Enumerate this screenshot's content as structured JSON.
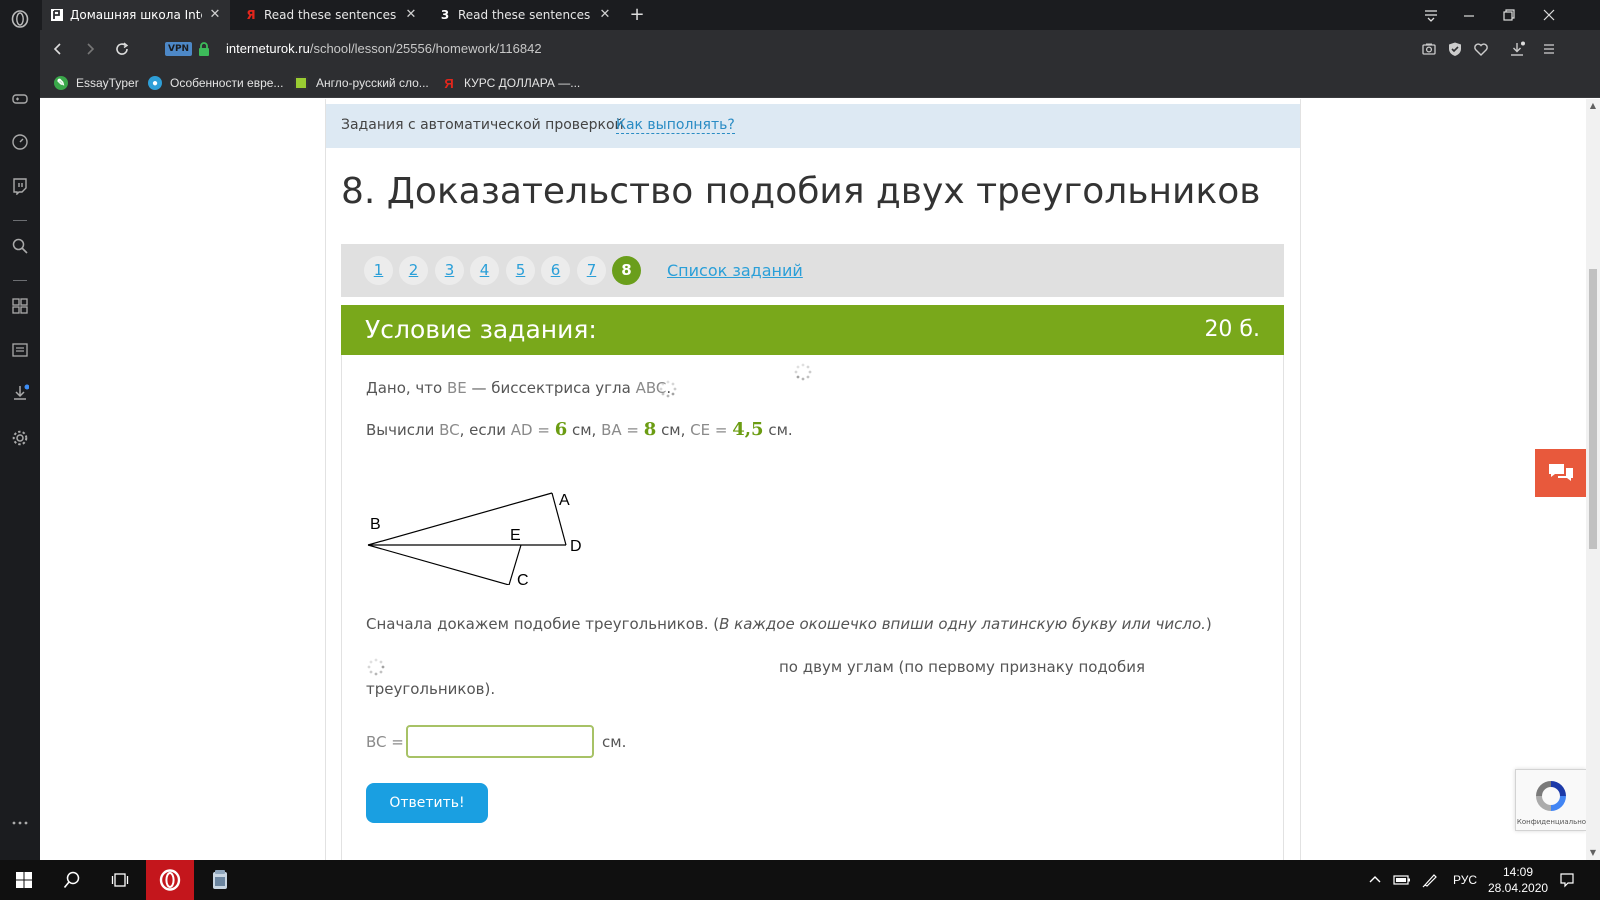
{
  "browser": {
    "tabs": [
      {
        "title": "Домашняя школа Internet",
        "active": true,
        "favicon": "interneturok-icon"
      },
      {
        "title": "Read these sentences and c",
        "active": false,
        "favicon": "yandex-icon"
      },
      {
        "title": "Read these sentences and f",
        "active": false,
        "favicon": "number-3-icon",
        "favicon_text": "3"
      }
    ],
    "new_tab_label": "+",
    "url_host": "interneturok.ru",
    "url_path": "/school/lesson/25556/homework/116842",
    "vpn_label": "VPN",
    "bookmarks": [
      {
        "label": "EssayTyper",
        "icon": "essaytyper-icon"
      },
      {
        "label": "Особенности евре...",
        "icon": "globe-icon"
      },
      {
        "label": "Англо-русский сло...",
        "icon": "dictionary-icon"
      },
      {
        "label": "КУРС ДОЛЛАРА —...",
        "icon": "yandex-icon"
      }
    ]
  },
  "page": {
    "autocheck_label": "Задания с автоматической проверкой",
    "howto_link": "Как выполнять?",
    "title": "8. Доказательство подобия двух треугольников",
    "pager": {
      "numbers": [
        "1",
        "2",
        "3",
        "4",
        "5",
        "6",
        "7",
        "8"
      ],
      "current_index": 7,
      "task_list_link": "Список заданий"
    },
    "task": {
      "header_title": "Условие задания:",
      "points": "20 б.",
      "given_prefix": "Дано, что ",
      "given_segment": "BE",
      "given_middle": " — биссектриса угла ",
      "given_angle": "ABC",
      "given_end": ".",
      "calc_prefix": "Вычисли ",
      "calc_target": "BC",
      "calc_if": ", если ",
      "ad_label": "AD =",
      "ad_value": "6",
      "unit_cm_comma_1": " см, ",
      "ba_label": "BA =",
      "ba_value": "8",
      "unit_cm_comma_2": " см, ",
      "ce_label": "CE =",
      "ce_value": "4,5",
      "unit_cm_end": " см.",
      "figure_labels": {
        "B": "B",
        "A": "A",
        "E": "E",
        "D": "D",
        "C": "C"
      },
      "proof_intro": "Сначала докажем подобие треугольников. (",
      "proof_hint": "В каждое окошечко впиши одну латинскую букву или число.",
      "proof_close": ")",
      "similarity_text": "по двум углам (по первому признаку подобия",
      "similarity_text_2": "треугольников).",
      "bc_label": "BC =",
      "bc_value": "",
      "bc_unit": "см.",
      "submit_label": "Ответить!"
    },
    "recaptcha_text": "Конфиденциально"
  },
  "taskbar": {
    "language": "РУС",
    "time": "14:09",
    "date": "28.04.2020"
  },
  "colors": {
    "task_header_green": "#79a81b",
    "value_green": "#6b9c12",
    "link_blue": "#2a9fd8",
    "submit_blue": "#1a9fe1",
    "chat_orange": "#e8593c",
    "browser_dark": "#1b1c1f"
  }
}
